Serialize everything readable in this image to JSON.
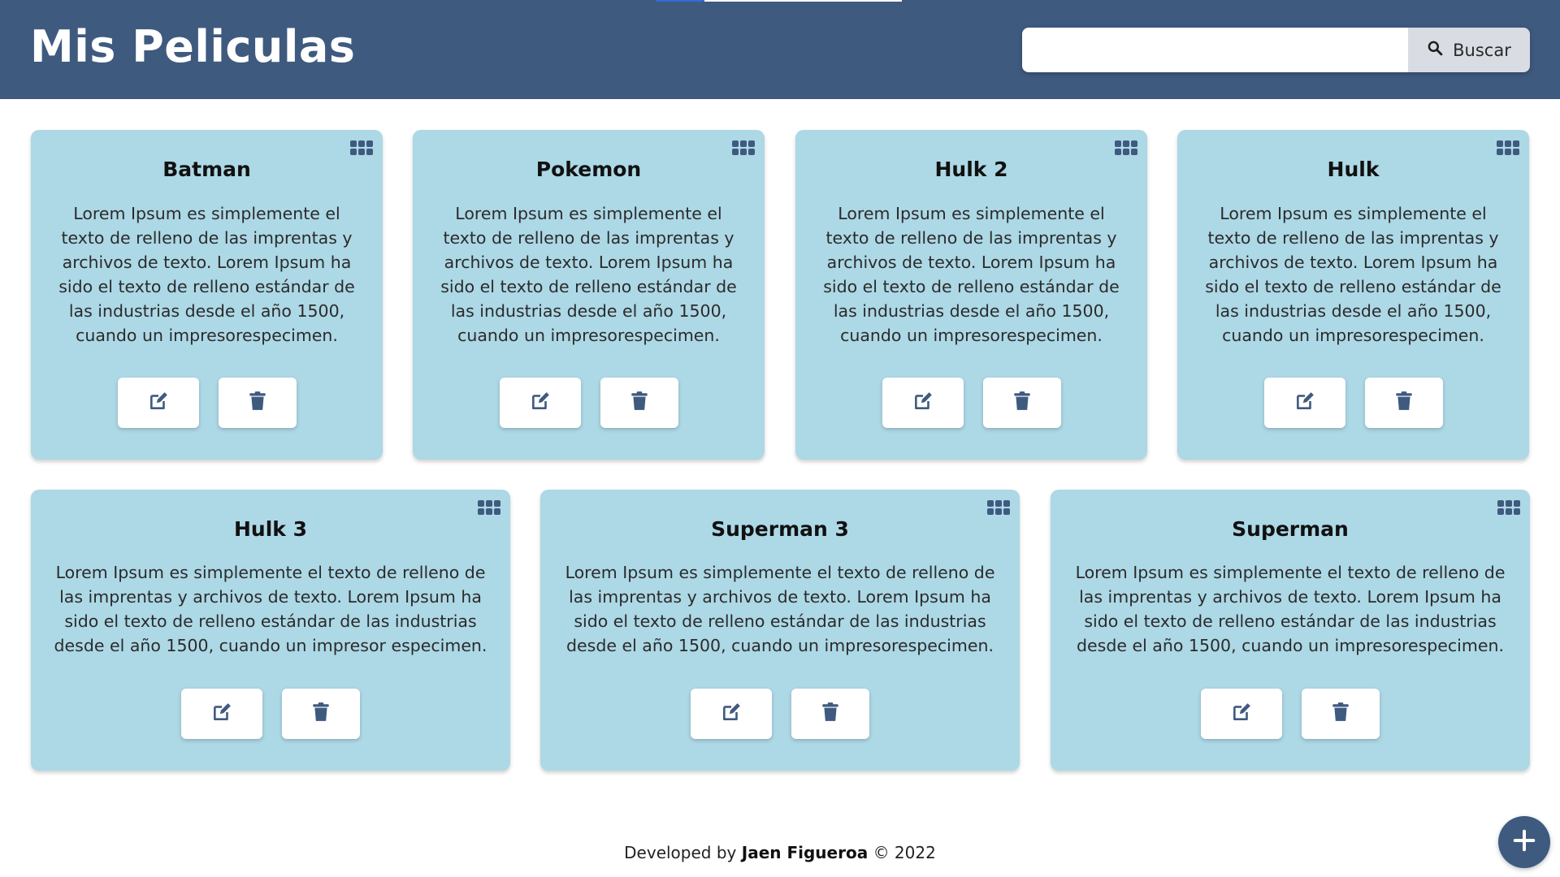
{
  "header": {
    "title": "Mis Peliculas",
    "search_placeholder": "",
    "search_button_label": "Buscar"
  },
  "icons": {
    "search": "search-icon",
    "menu": "grid-menu-icon",
    "edit": "edit-icon",
    "delete": "trash-icon",
    "add": "plus-icon"
  },
  "colors": {
    "header_bg": "#3f5a7f",
    "card_bg": "#add8e6",
    "icon_color": "#3f5a7f"
  },
  "movies": [
    {
      "title": "Batman",
      "description": "Lorem Ipsum es simplemente el texto de relleno de las imprentas y archivos de texto. Lorem Ipsum ha sido el texto de relleno estándar de las industrias desde el año 1500, cuando un impresorespecimen."
    },
    {
      "title": "Pokemon",
      "description": "Lorem Ipsum es simplemente el texto de relleno de las imprentas y archivos de texto. Lorem Ipsum ha sido el texto de relleno estándar de las industrias desde el año 1500, cuando un impresorespecimen."
    },
    {
      "title": "Hulk 2",
      "description": "Lorem Ipsum es simplemente el texto de relleno de las imprentas y archivos de texto. Lorem Ipsum ha sido el texto de relleno estándar de las industrias desde el año 1500, cuando un impresorespecimen."
    },
    {
      "title": "Hulk",
      "description": "Lorem Ipsum es simplemente el texto de relleno de las imprentas y archivos de texto. Lorem Ipsum ha sido el texto de relleno estándar de las industrias desde el año 1500, cuando un impresorespecimen."
    },
    {
      "title": "Hulk 3",
      "description": "Lorem Ipsum es simplemente el texto de relleno de las imprentas y archivos de texto. Lorem Ipsum ha sido el texto de relleno estándar de las industrias desde el año 1500, cuando un impresor especimen."
    },
    {
      "title": "Superman 3",
      "description": "Lorem Ipsum es simplemente el texto de relleno de las imprentas y archivos de texto. Lorem Ipsum ha sido el texto de relleno estándar de las industrias desde el año 1500, cuando un impresorespecimen."
    },
    {
      "title": "Superman",
      "description": "Lorem Ipsum es simplemente el texto de relleno de las imprentas y archivos de texto. Lorem Ipsum ha sido el texto de relleno estándar de las industrias desde el año 1500, cuando un impresorespecimen."
    }
  ],
  "footer": {
    "prefix": "Developed by",
    "author": "Jaen Figueroa",
    "suffix": "© 2022"
  }
}
